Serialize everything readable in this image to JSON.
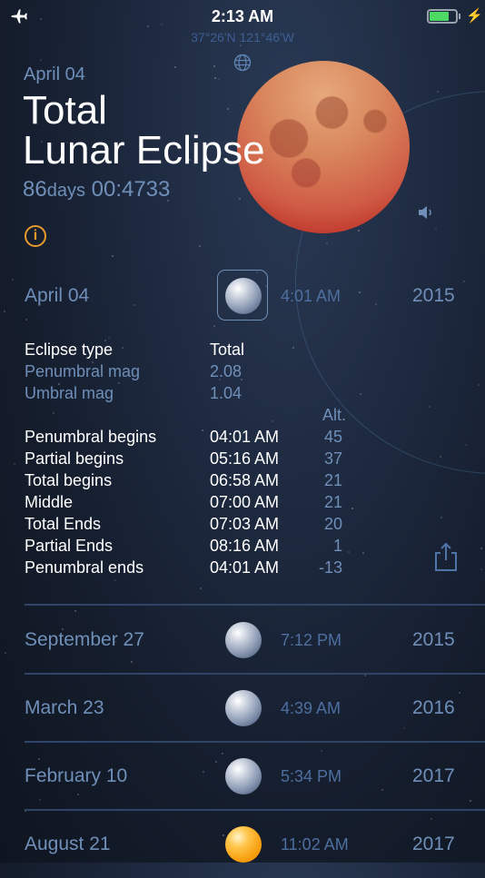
{
  "status_bar": {
    "time": "2:13 AM",
    "airplane_icon": "airplane-icon",
    "battery_icon": "battery-icon",
    "charging_icon": "lightning-icon",
    "charging_glyph": "⚡",
    "battery_level": 0.65,
    "battery_color": "#4cd964"
  },
  "location": {
    "coordinates": "37°26'N 121°46'W",
    "globe_icon": "globe-icon"
  },
  "header": {
    "date": "April 04",
    "title_line1": "Total",
    "title_line2": "Lunar Eclipse",
    "countdown_days": "86",
    "countdown_days_unit": "days",
    "countdown_time": " 00:4733",
    "info_icon": "info-icon",
    "info_glyph": "i",
    "speaker_icon": "speaker-icon",
    "info_color": "#e89a2b"
  },
  "selected_event": {
    "date": "April 04",
    "time": "4:01 AM",
    "year": "2015",
    "icon": "moon-icon"
  },
  "details": {
    "eclipse_type_label": "Eclipse type",
    "eclipse_type_value": "Total",
    "penumbral_mag_label": "Penumbral mag",
    "penumbral_mag_value": "2.08",
    "umbral_mag_label": "Umbral mag",
    "umbral_mag_value": "1.04",
    "alt_header": "Alt.",
    "phases": [
      {
        "label": "Penumbral begins",
        "time": "04:01 AM",
        "alt": "45"
      },
      {
        "label": "Partial begins",
        "time": "05:16 AM",
        "alt": "37"
      },
      {
        "label": "Total begins",
        "time": "06:58 AM",
        "alt": "21"
      },
      {
        "label": "Middle",
        "time": "07:00 AM",
        "alt": "21"
      },
      {
        "label": "Total Ends",
        "time": "07:03 AM",
        "alt": "20"
      },
      {
        "label": "Partial Ends",
        "time": "08:16 AM",
        "alt": "1"
      },
      {
        "label": "Penumbral ends",
        "time": "04:01 AM",
        "alt": "-13"
      }
    ],
    "share_icon": "share-icon"
  },
  "events": [
    {
      "date": "September 27",
      "time": "7:12 PM",
      "year": "2015",
      "icon": "moon-icon"
    },
    {
      "date": "March 23",
      "time": "4:39 AM",
      "year": "2016",
      "icon": "moon-icon"
    },
    {
      "date": "February 10",
      "time": "5:34 PM",
      "year": "2017",
      "icon": "moon-icon"
    },
    {
      "date": "August 21",
      "time": "11:02 AM",
      "year": "2017",
      "icon": "sun-icon"
    }
  ],
  "colors": {
    "accent_blue": "#6f8fb9",
    "eclipse_moon": "#cf5b45",
    "sun": "#f8a011"
  }
}
